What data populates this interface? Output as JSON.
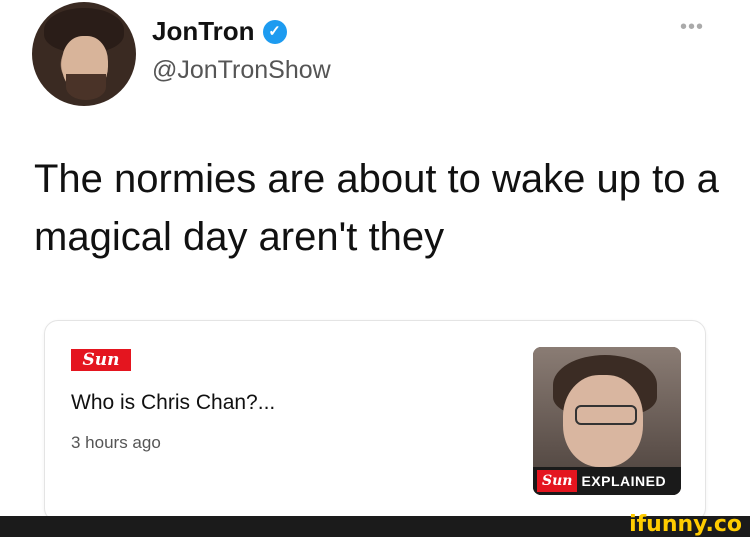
{
  "tweet": {
    "display_name": "JonTron",
    "handle": "@JonTronShow",
    "more_icon": "more-dots-icon",
    "text": "The normies are about to wake up to a magical day aren't they"
  },
  "card": {
    "source_logo": "Sun",
    "title": "Who is Chris Chan?...",
    "time": "3 hours ago",
    "thumbnail_logo": "Sun",
    "thumbnail_label": "EXPLAINED"
  },
  "watermark": {
    "text": "ifunny.co"
  },
  "colors": {
    "verified": "#1d9bf0",
    "sun_red": "#e4151f",
    "ifunny_yellow": "#ffcc00"
  }
}
